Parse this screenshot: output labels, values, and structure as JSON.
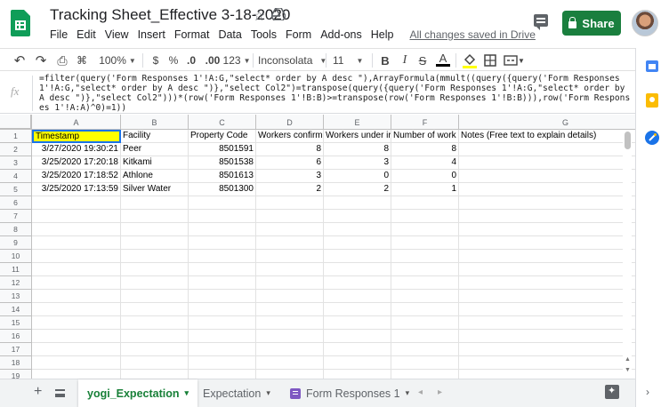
{
  "header": {
    "title": "Tracking Sheet_Effective 3-18-2020",
    "menu": [
      "File",
      "Edit",
      "View",
      "Insert",
      "Format",
      "Data",
      "Tools",
      "Form",
      "Add-ons",
      "Help"
    ],
    "save_status": "All changes saved in Drive",
    "share_label": "Share"
  },
  "toolbar": {
    "undo": "↶",
    "redo": "↷",
    "print": "⎙",
    "paint": "⌘",
    "zoom": "100%",
    "currency": "$",
    "percent": "%",
    "decimal_less": ".0",
    "decimal_more": ".00",
    "number_format": "123",
    "font": "Inconsolata",
    "font_size": "11",
    "bold": "B",
    "italic": "I",
    "strike": "S",
    "text_color": "A",
    "fill_icon": "paint-bucket-icon",
    "borders_icon": "borders-icon",
    "merge_icon": "merge-icon"
  },
  "formula": {
    "fx": "fx",
    "text": "=filter(query('Form Responses 1'!A:G,\"select* order by A desc \"),ArrayFormula(mmult((query({query('Form Responses 1'!A:G,\"select* order by A desc \")},\"select Col2\")=transpose(query({query('Form Responses 1'!A:G,\"select* order by A desc \")},\"select Col2\")))*(row('Form Responses 1'!B:B)>=transpose(row('Form Responses 1'!B:B))),row('Form Responses 1'!A:A)^0)=1))"
  },
  "grid": {
    "columns": [
      "A",
      "B",
      "C",
      "D",
      "E",
      "F",
      "G"
    ],
    "rows": [
      "1",
      "2",
      "3",
      "4",
      "5",
      "6",
      "7",
      "8",
      "9",
      "10",
      "11",
      "12",
      "13",
      "14",
      "15",
      "16",
      "17",
      "18",
      "19"
    ],
    "header_row": [
      "Timestamp",
      "Facility",
      "Property Code",
      "Workers confirm",
      "Workers under ir",
      "Number of work",
      "Notes (Free text to explain details)"
    ],
    "data": [
      [
        "3/27/2020 19:30:21",
        "Peer",
        "8501591",
        "8",
        "8",
        "8"
      ],
      [
        "3/25/2020 17:20:18",
        "Kitkami",
        "8501538",
        "6",
        "3",
        "4"
      ],
      [
        "3/25/2020 17:18:52",
        "Athlone",
        "8501613",
        "3",
        "0",
        "0"
      ],
      [
        "3/25/2020 17:13:59",
        "Silver Water",
        "8501300",
        "2",
        "2",
        "1"
      ]
    ]
  },
  "tabs": {
    "add": "+",
    "sheets": [
      {
        "label": "yogi_Expectation",
        "caret": "▾"
      },
      {
        "label": "Expectation",
        "caret": "▾"
      },
      {
        "label": "Form Responses 1",
        "caret": "▾"
      }
    ],
    "nav_left": "◂",
    "nav_right": "▸"
  },
  "colors": {
    "accent": "#188038",
    "share_button": "#1a7f3e",
    "selection_fill": "#ffff00",
    "selection_border": "#1a73e8"
  }
}
